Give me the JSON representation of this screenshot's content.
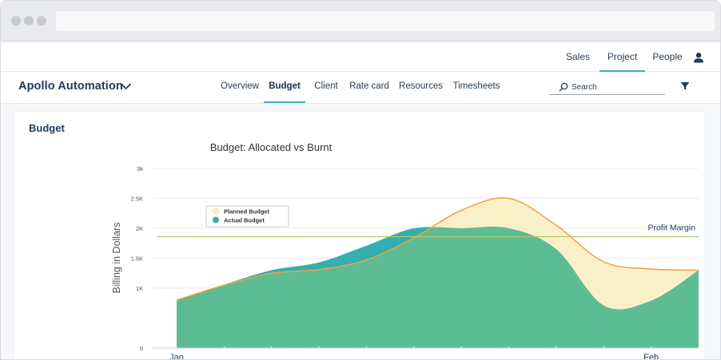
{
  "nav": {
    "items": [
      {
        "label": "Sales",
        "active": false
      },
      {
        "label": "Project",
        "active": true
      },
      {
        "label": "People",
        "active": false
      }
    ],
    "user_icon": "user-icon"
  },
  "project": {
    "name": "Apollo Automation",
    "icon": "chevron-down-icon"
  },
  "tabs": [
    {
      "label": "Overview",
      "active": false
    },
    {
      "label": "Budget",
      "active": true
    },
    {
      "label": "Client",
      "active": false
    },
    {
      "label": "Rate card",
      "active": false
    },
    {
      "label": "Resources",
      "active": false
    },
    {
      "label": "Timesheets",
      "active": false
    }
  ],
  "search": {
    "placeholder": "Search",
    "icon": "search-icon"
  },
  "filter": {
    "icon": "filter-icon"
  },
  "card": {
    "title": "Budget"
  },
  "colors": {
    "accent": "#39b3b3",
    "planned_fill": "#faf0c8",
    "planned_line": "#f0a23c",
    "actual_fill": "#5cbc94",
    "actual_overlap": "#35aeb0",
    "profit_line": "#b5c865"
  },
  "chart_data": {
    "type": "area",
    "title": "Budget: Allocated vs Burnt",
    "ylabel": "Billing in Dollars",
    "ylim": [
      0,
      3000
    ],
    "yticks": [
      0,
      500,
      1000,
      1500,
      2000,
      2500,
      3000
    ],
    "ytick_labels": [
      "0",
      "1K",
      "1.5K",
      "2K",
      "2.5K",
      "3k"
    ],
    "xtick_labels": [
      "Jan",
      "Feb"
    ],
    "legend_position": "top-left",
    "series": [
      {
        "name": "Planned Budget",
        "x": [
          1,
          2,
          3,
          4,
          5,
          6,
          7,
          8,
          9,
          10,
          11,
          12
        ],
        "values": [
          800,
          1050,
          1250,
          1310,
          1470,
          1840,
          2300,
          2500,
          2050,
          1440,
          1320,
          1300
        ]
      },
      {
        "name": "Actual Budget",
        "x": [
          1,
          2,
          3,
          4,
          5,
          6,
          7,
          8,
          9,
          10,
          11,
          12
        ],
        "values": [
          800,
          1060,
          1300,
          1430,
          1710,
          2000,
          2000,
          2000,
          1650,
          710,
          790,
          1300
        ]
      }
    ],
    "reference_line": {
      "label": "Profit Margin",
      "value": 1860
    }
  }
}
